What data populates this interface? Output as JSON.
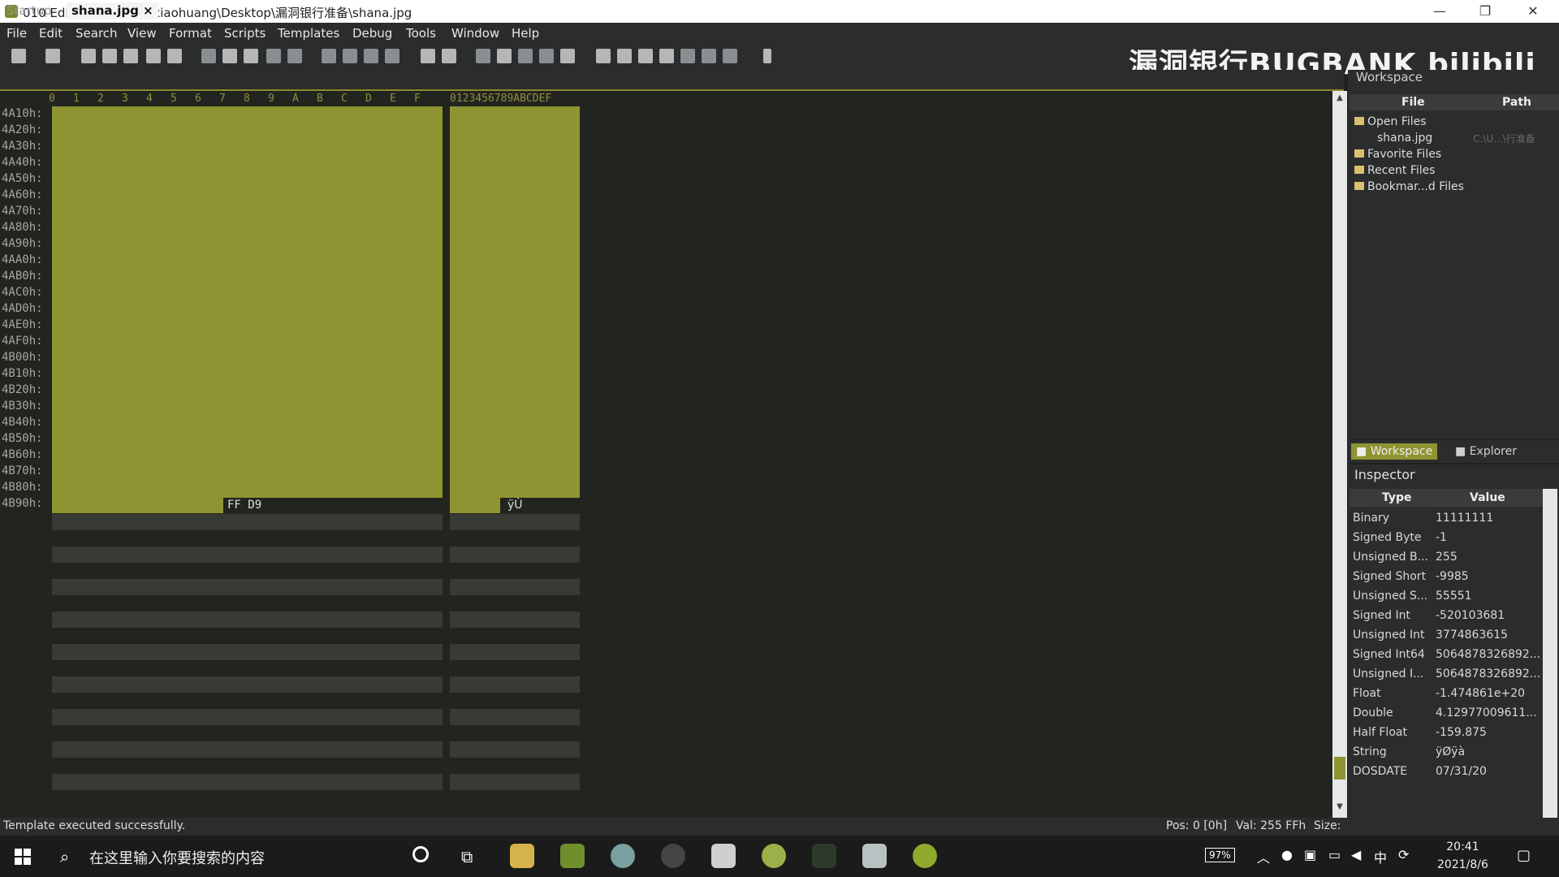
{
  "window": {
    "title": "010 Editor - C:\\Users\\xiaohuang\\Desktop\\漏洞银行准备\\shana.jpg",
    "controls": [
      "—",
      "❐",
      "✕"
    ]
  },
  "menu": [
    "File",
    "Edit",
    "Search",
    "View",
    "Format",
    "Scripts",
    "Templates",
    "Debug",
    "Tools",
    "Window",
    "Help"
  ],
  "watermark": "漏洞银行BUGBANK bilibili",
  "tabs": {
    "startup": "Startup",
    "active": "shana.jpg",
    "close": "×"
  },
  "hex": {
    "columns": [
      "0",
      "1",
      "2",
      "3",
      "4",
      "5",
      "6",
      "7",
      "8",
      "9",
      "A",
      "B",
      "C",
      "D",
      "E",
      "F"
    ],
    "ascii_header": "0123456789ABCDEF",
    "offsets": [
      "4A10h:",
      "4A20h:",
      "4A30h:",
      "4A40h:",
      "4A50h:",
      "4A60h:",
      "4A70h:",
      "4A80h:",
      "4A90h:",
      "4AA0h:",
      "4AB0h:",
      "4AC0h:",
      "4AD0h:",
      "4AE0h:",
      "4AF0h:",
      "4B00h:",
      "4B10h:",
      "4B20h:",
      "4B30h:",
      "4B40h:",
      "4B50h:",
      "4B60h:",
      "4B70h:",
      "4B80h:",
      "4B90h:"
    ],
    "last_bytes": "FF D9",
    "last_ascii": "ÿÙ"
  },
  "workspace": {
    "title": "Workspace",
    "col_file": "File",
    "col_path": "Path",
    "items": [
      {
        "label": "Open Files"
      },
      {
        "label": "shana.jpg",
        "path": "C:\\U...\\行准备"
      },
      {
        "label": "Favorite Files"
      },
      {
        "label": "Recent Files"
      },
      {
        "label": "Bookmar...d Files"
      }
    ],
    "tab_workspace": "Workspace",
    "tab_explorer": "Explorer"
  },
  "inspector": {
    "title": "Inspector",
    "col_type": "Type",
    "col_value": "Value",
    "rows": [
      {
        "type": "Binary",
        "value": "11111111"
      },
      {
        "type": "Signed Byte",
        "value": "-1"
      },
      {
        "type": "Unsigned B...",
        "value": "255"
      },
      {
        "type": "Signed Short",
        "value": "-9985"
      },
      {
        "type": "Unsigned S...",
        "value": "55551"
      },
      {
        "type": "Signed Int",
        "value": "-520103681"
      },
      {
        "type": "Unsigned Int",
        "value": "3774863615"
      },
      {
        "type": "Signed Int64",
        "value": "5064878326892..."
      },
      {
        "type": "Unsigned I...",
        "value": "5064878326892..."
      },
      {
        "type": "Float",
        "value": "-1.474861e+20"
      },
      {
        "type": "Double",
        "value": "4.12977009611..."
      },
      {
        "type": "Half Float",
        "value": "-159.875"
      },
      {
        "type": "String",
        "value": "ÿØÿà"
      },
      {
        "type": "DOSDATE",
        "value": "07/31/20"
      }
    ]
  },
  "status": {
    "message": "Template executed successfully.",
    "pos": "Pos: 0 [0h]",
    "val": "Val: 255 FFh",
    "size": "Size:"
  },
  "taskbar": {
    "search_placeholder": "在这里输入你要搜索的内容",
    "battery": "97%",
    "time": "20:41",
    "date": "2021/8/6"
  },
  "colors": {
    "highlight": "#8f9432",
    "accent": "#8a8a2a"
  }
}
